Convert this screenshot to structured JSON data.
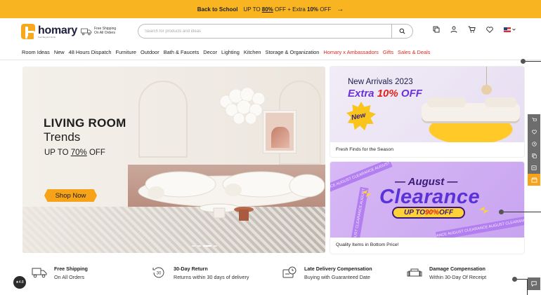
{
  "promo": {
    "prefix": "Back to School",
    "mid1": "UP TO ",
    "pct1": "80%",
    "mid2": " OFF + Extra ",
    "pct2": "10%",
    "mid3": " OFF",
    "arrow": "→"
  },
  "header": {
    "logo_word": "homary",
    "logo_tag": "Feel Beyond Smile",
    "free_ship_line1": "Free Shipping",
    "free_ship_line2": "On All Orders",
    "search_placeholder": "Search for products and ideas",
    "country": "US"
  },
  "nav": [
    {
      "label": "Room Ideas",
      "red": false
    },
    {
      "label": "New",
      "red": false
    },
    {
      "label": "48 Hours Dispatch",
      "red": false
    },
    {
      "label": "Furniture",
      "red": false
    },
    {
      "label": "Outdoor",
      "red": false
    },
    {
      "label": "Bath & Faucets",
      "red": false
    },
    {
      "label": "Decor",
      "red": false
    },
    {
      "label": "Lighting",
      "red": false
    },
    {
      "label": "Kitchen",
      "red": false
    },
    {
      "label": "Storage & Organization",
      "red": false
    },
    {
      "label": "Homary x Ambassadors",
      "red": true
    },
    {
      "label": "Gifts",
      "red": true
    },
    {
      "label": "Sales & Deals",
      "red": true
    }
  ],
  "hero": {
    "title": "LIVING ROOM",
    "subtitle": "Trends",
    "offer_prefix": "UP TO ",
    "offer_pct": "70%",
    "offer_suffix": " OFF",
    "button": "Shop Now",
    "active_slide_index": 2,
    "slide_count": 4
  },
  "card1": {
    "line1": "New Arrivals 2023",
    "line2_a": "Extra ",
    "line2_b": "10%",
    "line2_c": " OFF",
    "badge": "New",
    "caption": "Fresh Finds for the Season"
  },
  "card2": {
    "line1": "— August —",
    "line2": "Clearance",
    "offer_a": "UP TO ",
    "offer_b": "90%",
    "offer_c": " OFF",
    "tape_text": "ANCE AUGUST CLEARANCE AUGUST CLEARANCE AUGUST",
    "caption": "Quality Items in Bottom Price!"
  },
  "perks": [
    {
      "icon": "truck-icon",
      "title": "Free Shipping",
      "sub": "On All Orders"
    },
    {
      "icon": "return-30-icon",
      "title": "30-Day Return",
      "sub": "Returns within 30 days of delivery"
    },
    {
      "icon": "clock-delivery-icon",
      "title": "Late Delivery Compensation",
      "sub": "Buying with Guaranteed Date"
    },
    {
      "icon": "damage-sofa-icon",
      "title": "Damage Compensation",
      "sub": "Within 30-Day Of Receipt"
    }
  ],
  "rating": "★4.8",
  "colors": {
    "accent": "#f6a31a",
    "promo_bg": "#f8b421",
    "sale_red": "#e0261b",
    "brand_navy": "#1e1e3c"
  }
}
